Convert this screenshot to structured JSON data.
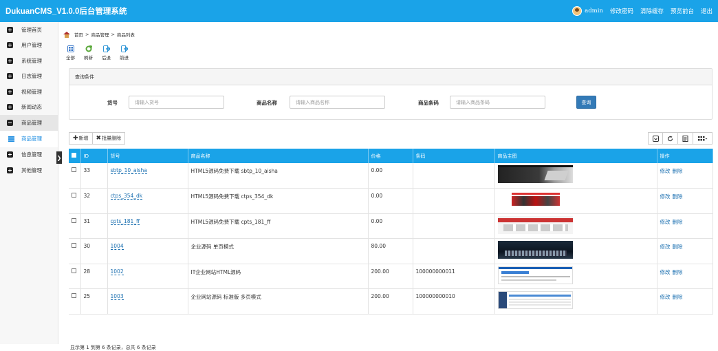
{
  "header": {
    "title": "DukuanCMS_V1.0.0后台管理系统",
    "user": "admin",
    "links": [
      "修改密码",
      "清除缓存",
      "预览前台",
      "退出"
    ]
  },
  "sidebar": {
    "items": [
      {
        "label": "管理首页",
        "icon": "plus-square-icon"
      },
      {
        "label": "用户管理",
        "icon": "plus-square-icon"
      },
      {
        "label": "系统管理",
        "icon": "plus-square-icon"
      },
      {
        "label": "日志管理",
        "icon": "plus-square-icon"
      },
      {
        "label": "视频管理",
        "icon": "plus-square-icon"
      },
      {
        "label": "新闻动态",
        "icon": "plus-square-icon"
      },
      {
        "label": "商品管理",
        "icon": "minus-square-icon"
      },
      {
        "label": "信息管理",
        "icon": "plus-square-icon"
      },
      {
        "label": "其他管理",
        "icon": "plus-square-icon"
      }
    ],
    "active_sub": "商品管理",
    "collapse_glyph": "❯"
  },
  "breadcrumb": [
    "首页",
    "商品管理",
    "商品列表"
  ],
  "breadcrumb_sep": ">",
  "toolbar": [
    {
      "label": "全部",
      "icon": "grid-icon",
      "color": "#3a78c9"
    },
    {
      "label": "刷新",
      "icon": "refresh-icon",
      "color": "#5aa83a"
    },
    {
      "label": "后退",
      "icon": "back-icon",
      "color": "#2f95d6"
    },
    {
      "label": "前进",
      "icon": "forward-icon",
      "color": "#2f95d6"
    }
  ],
  "query": {
    "title": "查询条件",
    "fields": [
      {
        "label": "货号",
        "placeholder": "请输入货号"
      },
      {
        "label": "商品名称",
        "placeholder": "请输入商品名称"
      },
      {
        "label": "商品条码",
        "placeholder": "请输入商品条码"
      }
    ],
    "button": "查询"
  },
  "actions": {
    "add": "新增",
    "batch_delete": "批量删除",
    "add_glyph": "✚",
    "delete_glyph": "✖"
  },
  "table": {
    "columns": [
      "",
      "ID",
      "货号",
      "商品名称",
      "价格",
      "条码",
      "商品主图",
      "操作"
    ],
    "rows": [
      {
        "id": "33",
        "code": "sbtp_10_aisha",
        "name": "HTML5源码免费下载 sbtp_10_aisha",
        "price": "0.00",
        "barcode": "",
        "thumb": "dark-laptop"
      },
      {
        "id": "32",
        "code": "ctps_354_dk",
        "name": "HTML5源码免费下载 ctps_354_dk",
        "price": "0.00",
        "barcode": "",
        "thumb": "red-cars"
      },
      {
        "id": "31",
        "code": "cpts_181_ff",
        "name": "HTML5源码免费下载 cpts_181_ff",
        "price": "0.00",
        "barcode": "",
        "thumb": "red-grid"
      },
      {
        "id": "30",
        "code": "1004",
        "name": "企业源码 单页模式",
        "price": "80.00",
        "barcode": "",
        "thumb": "dark-keyboard"
      },
      {
        "id": "28",
        "code": "1002",
        "name": "IT企业网站HTML源码",
        "price": "200.00",
        "barcode": "100000000011",
        "thumb": "blue-site"
      },
      {
        "id": "25",
        "code": "1003",
        "name": "企业网站源码 标准版 多页模式",
        "price": "200.00",
        "barcode": "100000000010",
        "thumb": "admin-page"
      }
    ],
    "op_edit": "修改",
    "op_delete": "删除"
  },
  "footer": "显示第 1 到第 6 条记录，总共 6 条记录",
  "colors": {
    "accent": "#1aa3e8",
    "link": "#1a6fb0",
    "primary_button": "#337ab7"
  }
}
